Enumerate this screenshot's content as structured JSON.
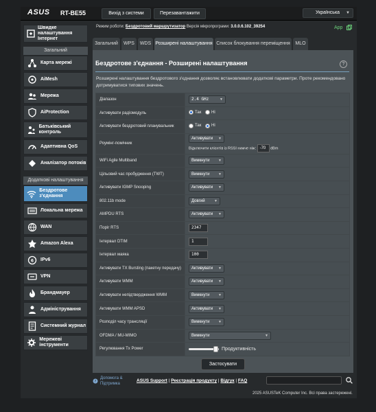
{
  "header": {
    "brand": "ASUS",
    "model": "RT-BE55",
    "logout_label": "Вихід з системи",
    "reboot_label": "Перезавантажити",
    "language": "Українська"
  },
  "status": {
    "mode_label": "Режим роботи:",
    "mode_value": "Бездротовий маршрутизатор",
    "firmware_label": "Версія мікропрограми:",
    "firmware_value": "3.0.0.6.102_39254",
    "app_label": "App"
  },
  "sidebar": {
    "quick_setup": "Швидке налаштування Інтернет",
    "general_header": "Загальний",
    "general_items": [
      {
        "label": "Карта мережі",
        "icon": "network-map-icon"
      },
      {
        "label": "AiMesh",
        "icon": "aimesh-icon"
      },
      {
        "label": "Мережа",
        "icon": "guest-network-icon"
      },
      {
        "label": "AiProtection",
        "icon": "aiprotection-icon"
      },
      {
        "label": "Батьківський контроль",
        "icon": "parental-control-icon"
      },
      {
        "label": "Адаптивна QoS",
        "icon": "qos-icon"
      },
      {
        "label": "Аналізатор потоків",
        "icon": "traffic-analyzer-icon"
      }
    ],
    "advanced_header": "Додаткові налаштування",
    "advanced_items": [
      {
        "label": "Бездротове з'єднання",
        "icon": "wireless-icon"
      },
      {
        "label": "Локальна мережа",
        "icon": "lan-icon"
      },
      {
        "label": "WAN",
        "icon": "wan-icon"
      },
      {
        "label": "Amazon Alexa",
        "icon": "alexa-icon"
      },
      {
        "label": "IPv6",
        "icon": "ipv6-icon"
      },
      {
        "label": "VPN",
        "icon": "vpn-icon"
      },
      {
        "label": "Брандмауер",
        "icon": "firewall-icon"
      },
      {
        "label": "Адміністрування",
        "icon": "administration-icon"
      },
      {
        "label": "Системний журнал",
        "icon": "system-log-icon"
      },
      {
        "label": "Мережеві інструменти",
        "icon": "network-tools-icon"
      }
    ]
  },
  "tabs": [
    {
      "label": "Загальний"
    },
    {
      "label": "WPS"
    },
    {
      "label": "WDS"
    },
    {
      "label": "Розширені налаштування"
    },
    {
      "label": "Список блокування переміщення"
    },
    {
      "label": "MLO"
    }
  ],
  "main": {
    "title": "Бездротове з'єднання - Розширені налаштування",
    "description": "Розширені налаштування бездротового з'єднання дозволяє встановлювати додаткові параметри. Проте рекомендовано дотримуватися типових значень.",
    "rows": {
      "band": {
        "label": "Діапазон",
        "value": "2.4 GHz"
      },
      "radio": {
        "label": "Активувати радіомодуль",
        "yes": "Так",
        "no": "Ні"
      },
      "scheduler": {
        "label": "Активувати бездротовий планувальник",
        "yes": "Так",
        "no": "Ні"
      },
      "roaming": {
        "label": "Роумінг-помічник",
        "value": "Активувати",
        "rssi_label": "Відключити клієнтів із RSSI нижче ніж:",
        "rssi_value": "-70",
        "rssi_unit": "dBm"
      },
      "multiband": {
        "label": "WiFi Agile Multiband",
        "value": "Вимкнути"
      },
      "twt": {
        "label": "Цільовий час пробудження (TWT)",
        "value": "Вимкнути"
      },
      "igmp": {
        "label": "Активувати IGMP Snooping",
        "value": "Активувати"
      },
      "b_mode": {
        "label": "802.11b mode",
        "value": "Довгий"
      },
      "ampdu": {
        "label": "AMPDU RTS",
        "value": "Активувати"
      },
      "rts": {
        "label": "Поріг RTS",
        "value": "2347"
      },
      "dtim": {
        "label": "Інтервал DTIM",
        "value": "1"
      },
      "beacon": {
        "label": "Інтервал маяка",
        "value": "100"
      },
      "tx_burst": {
        "label": "Активувати TX Bursting (пакетну передачу)",
        "value": "Активувати"
      },
      "wmm": {
        "label": "Активувати WMM",
        "value": "Активувати"
      },
      "wmm_noack": {
        "label": "Активувати непідтвердження WMM",
        "value": "Вимкнути"
      },
      "wmm_apsd": {
        "label": "Активувати WMM APSD",
        "value": "Активувати"
      },
      "airtime": {
        "label": "Розподіл часу трансляції",
        "value": "Вимкнути"
      },
      "ofdma": {
        "label": "OFDMA / MU-MIMO",
        "value": "Вимкнути"
      },
      "txpower": {
        "label": "Регулювання Tx Power",
        "level": 0.9,
        "value_label": "Продуктивність"
      }
    },
    "apply_label": "Застосувати"
  },
  "footer": {
    "help_label": "Допомога & Підтримка",
    "links": [
      "ASUS Support",
      "Реєстрація продукту",
      "Відгук",
      "FAQ"
    ],
    "copyright": "2025 ASUSTeK Computer Inc. Всі права застережені."
  },
  "colors": {
    "accent": "#4d8cbd",
    "app_green": "#6bd07a"
  }
}
